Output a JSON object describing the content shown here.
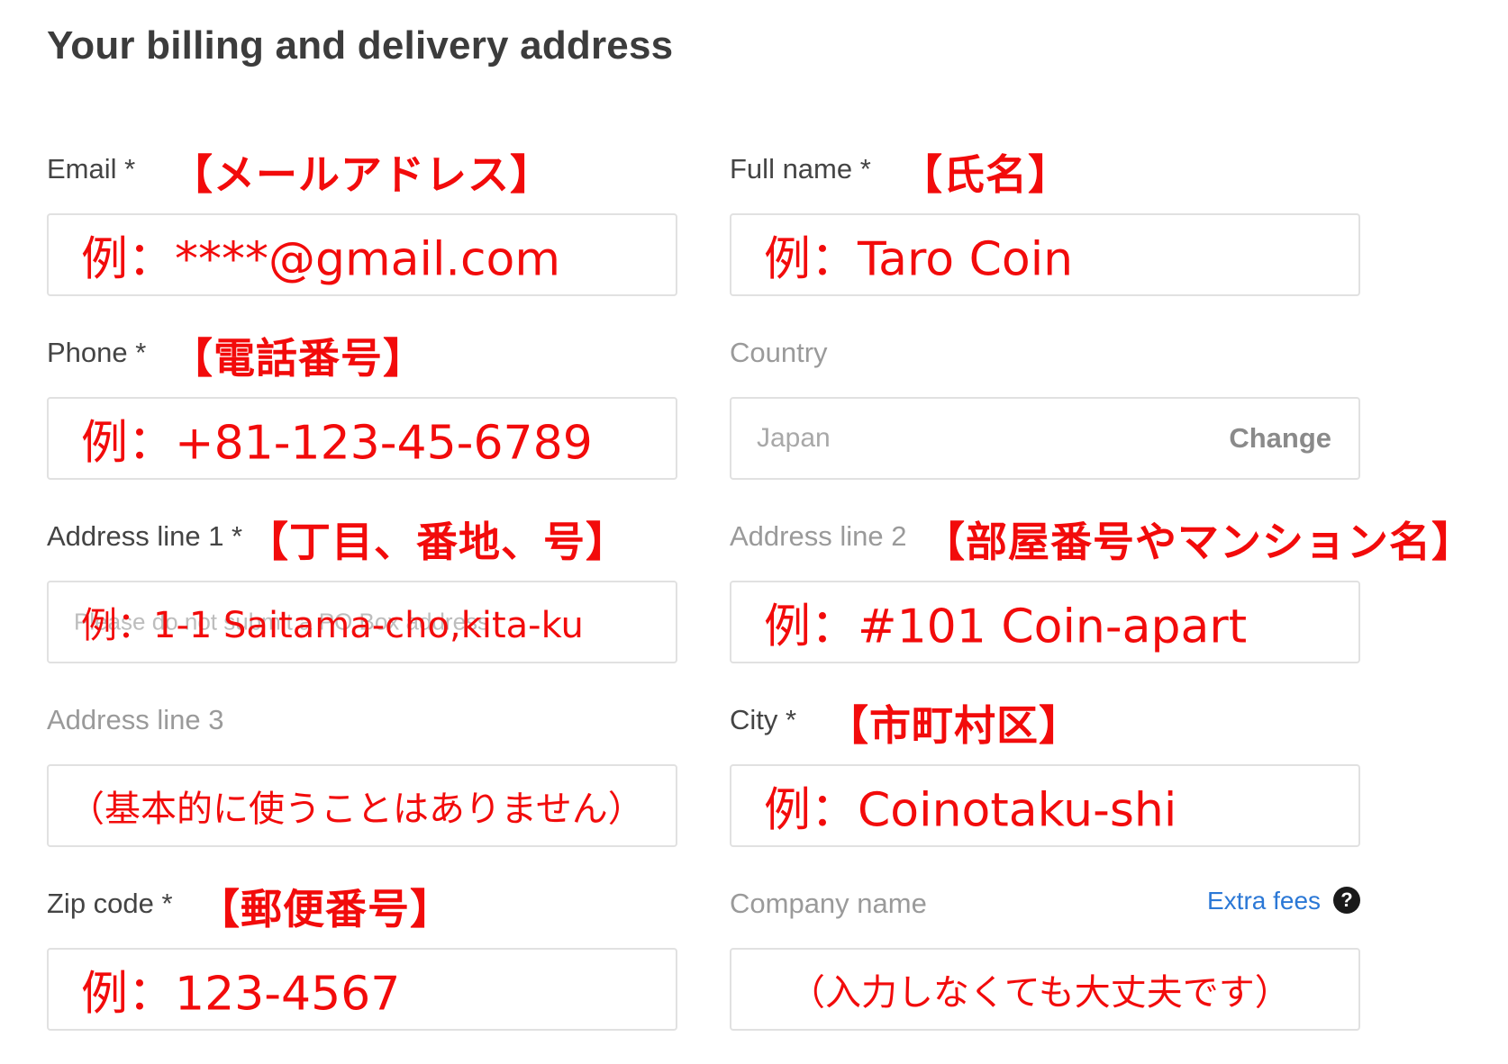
{
  "title": "Your billing and delivery address",
  "fields": {
    "email": {
      "label": "Email *",
      "note": "【メールアドレス】",
      "value": "例：****@gmail.com"
    },
    "full_name": {
      "label": "Full name *",
      "note": "【氏名】",
      "value": "例：Taro Coin"
    },
    "phone": {
      "label": "Phone *",
      "note": "【電話番号】",
      "value": "例：+81-123-45-6789"
    },
    "country": {
      "label": "Country",
      "value": "Japan",
      "change_label": "Change"
    },
    "address1": {
      "label": "Address line 1 *",
      "note": "【丁目、番地、号】",
      "placeholder": "Please do not submit a PO Box address",
      "value": "例：1-1 Saitama-cho,kita-ku"
    },
    "address2": {
      "label": "Address line 2",
      "note": "【部屋番号やマンション名】",
      "value": "例：#101 Coin-apart"
    },
    "address3": {
      "label": "Address line 3",
      "value": "（基本的に使うことはありません）"
    },
    "city": {
      "label": "City *",
      "note": "【市町村区】",
      "value": "例：Coinotaku-shi"
    },
    "zip": {
      "label": "Zip code *",
      "note": "【郵便番号】",
      "value": "例：123-4567"
    },
    "company": {
      "label": "Company name",
      "extra_fees": "Extra fees",
      "help_icon": "?",
      "value": "（入力しなくても大丈夫です）"
    }
  },
  "colors": {
    "annotation": "#f20b0b",
    "link": "#2b78d6",
    "label": "#444444",
    "muted": "#9a9a9a",
    "border": "#e1e1e1"
  }
}
